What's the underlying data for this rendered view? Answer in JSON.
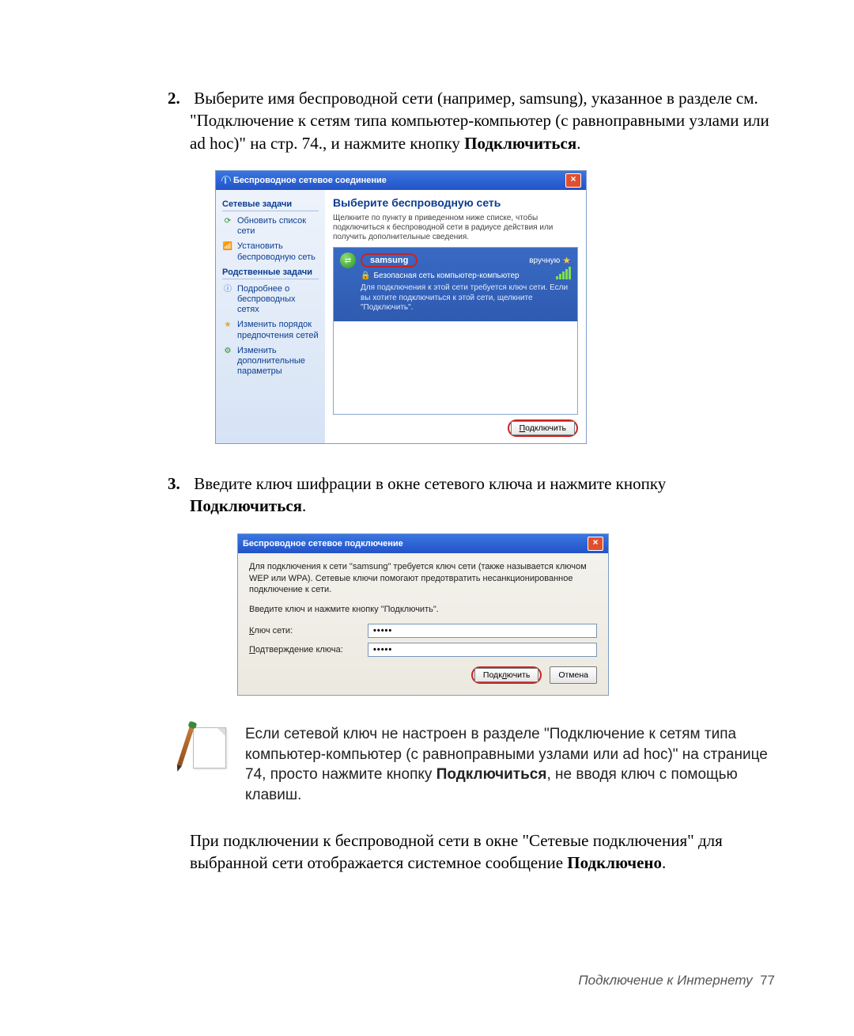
{
  "step2": {
    "num": "2.",
    "text_a": "Выберите имя беспроводной сети (например, samsung), указанное в разделе см. \"Подключение к сетям типа компьютер-компьютер (с равноправными узлами или ad hoc)\" на стр. 74., и нажмите кнопку ",
    "bold": "Подключиться",
    "text_b": "."
  },
  "shot1": {
    "title": "Беспроводное сетевое соединение",
    "side": {
      "h1": "Сетевые задачи",
      "task_refresh": "Обновить список сети",
      "task_setup": "Установить беспроводную сеть",
      "h2": "Родственные задачи",
      "task_more": "Подробнее о беспроводных сетях",
      "task_order": "Изменить порядок предпочтения сетей",
      "task_adv": "Изменить дополнительные параметры"
    },
    "main": {
      "title": "Выберите беспроводную сеть",
      "sub": "Щелкните по пункту в приведенном ниже списке, чтобы подключиться к беспроводной сети в радиусе действия или получить дополнительные сведения.",
      "net": {
        "name": "samsung",
        "manual": "вручную",
        "secure": "Безопасная сеть компьютер-компьютер",
        "hint": "Для подключения к этой сети требуется ключ сети. Если вы хотите подключиться к этой сети, щелкните \"Подключить\"."
      },
      "button": "Подключить"
    }
  },
  "step3": {
    "num": "3.",
    "text_a": "Введите ключ шифрации в окне сетевого ключа и нажмите кнопку ",
    "bold": "Подключиться",
    "text_b": "."
  },
  "shot2": {
    "title": "Беспроводное сетевое подключение",
    "p1": "Для подключения к сети \"samsung\" требуется ключ сети (также называется ключом WEP или WPA). Сетевые ключи помогают предотвратить несанкционированное подключение к сети.",
    "p2": "Введите ключ и нажмите кнопку \"Подключить\".",
    "lbl_key_pre": "К",
    "lbl_key_rest": "люч сети:",
    "lbl_conf_pre": "П",
    "lbl_conf_rest": "одтверждение ключа:",
    "val": "•••••",
    "btn_ok_pre": "Подк",
    "btn_ok_u": "л",
    "btn_ok_post": "ючить",
    "btn_cancel": "Отмена"
  },
  "note": {
    "t1": "Если сетевой ключ не настроен в разделе ",
    "t2": "\"Подключение к сетям типа компьютер-компьютер (с равноправными узлами или ad hoc)\" на странице 74",
    "t3": ", просто нажмите кнопку ",
    "bold": "Подключиться",
    "t4": ", не вводя ключ с помощью клавиш."
  },
  "closing": {
    "a": "При подключении к беспроводной сети в окне \"Сетевые подключения\" для выбранной сети отображается системное сообщение ",
    "bold": "Подключено",
    "b": "."
  },
  "footer": {
    "label": "Подключение к Интернету",
    "page": "77"
  }
}
